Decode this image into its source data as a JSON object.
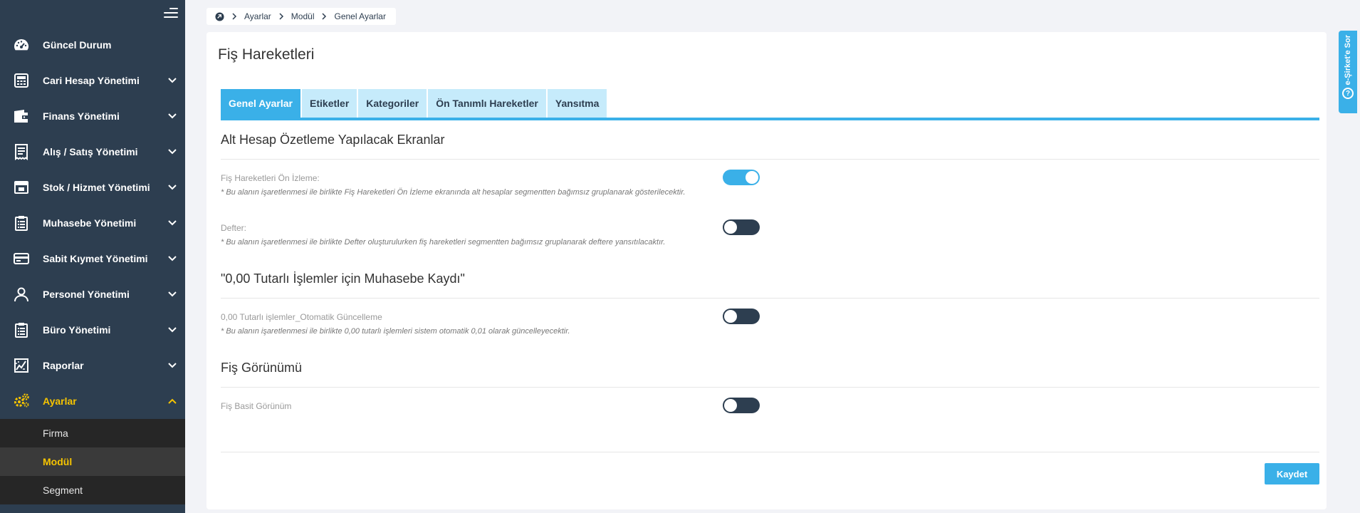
{
  "sidebar": {
    "items": [
      {
        "label": "Güncel Durum",
        "icon": "dashboard-icon",
        "has_chevron": false
      },
      {
        "label": "Cari Hesap Yönetimi",
        "icon": "calculator-icon",
        "has_chevron": true
      },
      {
        "label": "Finans Yönetimi",
        "icon": "wallet-icon",
        "has_chevron": true
      },
      {
        "label": "Alış / Satış Yönetimi",
        "icon": "receipt-icon",
        "has_chevron": true
      },
      {
        "label": "Stok / Hizmet Yönetimi",
        "icon": "box-icon",
        "has_chevron": true
      },
      {
        "label": "Muhasebe Yönetimi",
        "icon": "clipboard-icon",
        "has_chevron": true
      },
      {
        "label": "Sabit Kıymet Yönetimi",
        "icon": "card-icon",
        "has_chevron": true
      },
      {
        "label": "Personel Yönetimi",
        "icon": "person-icon",
        "has_chevron": true
      },
      {
        "label": "Büro Yönetimi",
        "icon": "clipboard-icon",
        "has_chevron": true
      },
      {
        "label": "Raporlar",
        "icon": "chart-icon",
        "has_chevron": true
      },
      {
        "label": "Ayarlar",
        "icon": "gears-icon",
        "has_chevron": true,
        "active": true
      }
    ],
    "submenu": [
      {
        "label": "Firma"
      },
      {
        "label": "Modül",
        "active": true
      },
      {
        "label": "Segment"
      }
    ]
  },
  "breadcrumb": [
    "Ayarlar",
    "Modül",
    "Genel Ayarlar"
  ],
  "page_title": "Fiş Hareketleri",
  "tabs": [
    "Genel Ayarlar",
    "Etiketler",
    "Kategoriler",
    "Ön Tanımlı Hareketler",
    "Yansıtma"
  ],
  "sections": [
    {
      "title": "Alt Hesap Özetleme Yapılacak Ekranlar",
      "fields": [
        {
          "label": "Fiş Hareketleri Ön İzleme:",
          "note": "* Bu alanın işaretlenmesi ile birlikte Fiş Hareketleri Ön İzleme ekranında alt hesaplar segmentten bağımsız gruplanarak gösterilecektir.",
          "enabled": true
        },
        {
          "label": "Defter:",
          "note": "* Bu alanın işaretlenmesi ile birlikte Defter oluşturulurken fiş hareketleri segmentten bağımsız gruplanarak deftere yansıtılacaktır.",
          "enabled": false
        }
      ]
    },
    {
      "title": "\"0,00 Tutarlı İşlemler için Muhasebe Kaydı\"",
      "fields": [
        {
          "label": "0,00 Tutarlı işlemler_Otomatik Güncelleme",
          "note": "* Bu alanın işaretlenmesi ile birlikte 0,00 tutarlı işlemleri sistem otomatik 0,01 olarak güncelleyecektir.",
          "enabled": false
        }
      ]
    },
    {
      "title": "Fiş Görünümü",
      "fields": [
        {
          "label": "Fiş Basit Görünüm",
          "enabled": false
        }
      ]
    }
  ],
  "save_label": "Kaydet",
  "help_tab": {
    "label": "e-Şirket'e Sor",
    "icon": "?"
  },
  "colors": {
    "sidebar_bg": "#2d3e50",
    "accent": "#3ab0e8",
    "active_menu": "#f6c400",
    "tab_inactive": "#c6ebfb"
  }
}
